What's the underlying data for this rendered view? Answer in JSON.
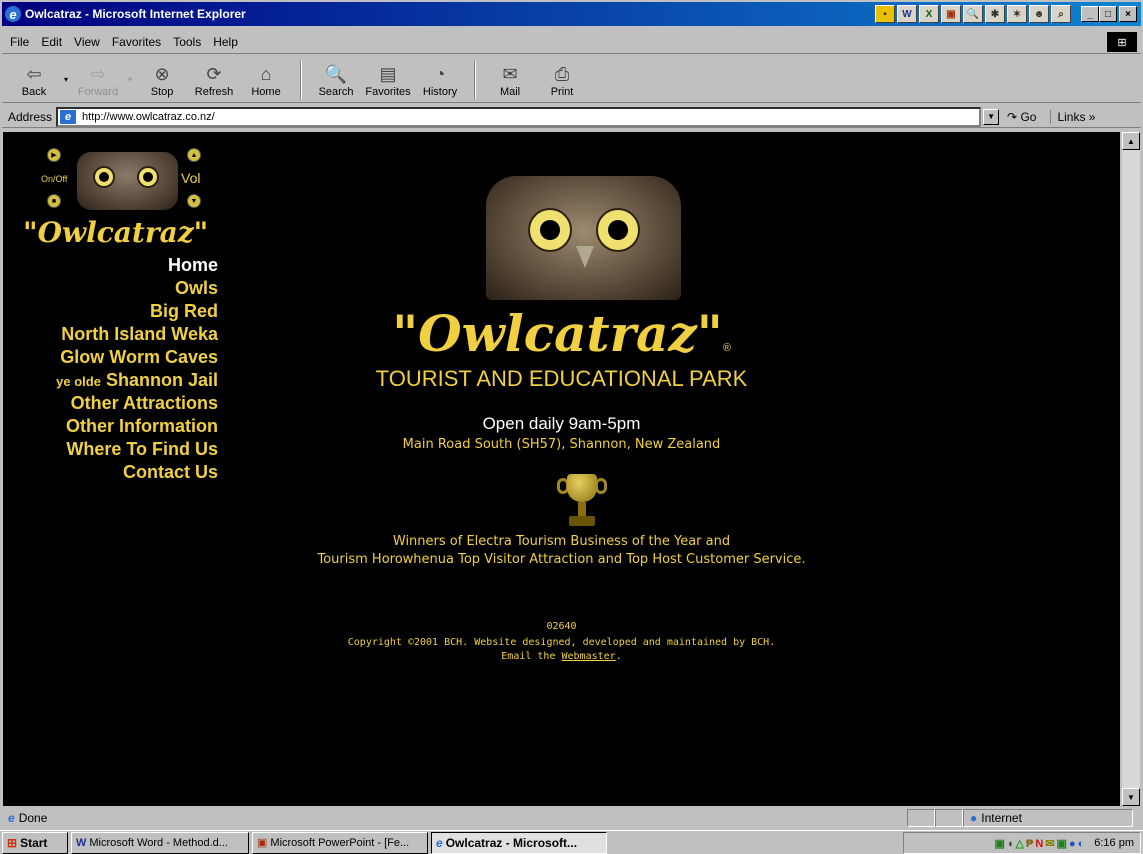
{
  "window": {
    "title": "Owlcatraz - Microsoft Internet Explorer",
    "caption_buttons": [
      "_",
      "□",
      "×"
    ]
  },
  "menu": [
    "File",
    "Edit",
    "View",
    "Favorites",
    "Tools",
    "Help"
  ],
  "toolbar": {
    "back": "Back",
    "forward": "Forward",
    "stop": "Stop",
    "refresh": "Refresh",
    "home": "Home",
    "search": "Search",
    "favorites": "Favorites",
    "history": "History",
    "mail": "Mail",
    "print": "Print"
  },
  "address": {
    "label": "Address",
    "url": "http://www.owlcatraz.co.nz/",
    "go": "Go",
    "links": "Links »"
  },
  "page": {
    "audio": {
      "onoff": "On/Off",
      "vol": "Vol"
    },
    "side_logo": "\"Owlcatraz\"",
    "nav": [
      {
        "label": "Home",
        "color": "#ffffff"
      },
      {
        "label": "Owls"
      },
      {
        "label": "Big Red"
      },
      {
        "label": "North Island Weka"
      },
      {
        "label": "Glow Worm Caves"
      },
      {
        "prefix": "ye olde",
        "label": "Shannon Jail"
      },
      {
        "label": "Other Attractions"
      },
      {
        "label": "Other Information"
      },
      {
        "label": "Where To Find Us"
      },
      {
        "label": "Contact Us"
      }
    ],
    "main_logo": "\"Owlcatraz\"",
    "registered": "®",
    "subtitle": "TOURIST AND EDUCATIONAL PARK",
    "open_prefix": "Open daily",
    "open_hours": "9am-5pm",
    "address_line": "Main Road South (SH57), Shannon, New Zealand",
    "award_line1": "Winners of Electra Tourism Business of the Year and",
    "award_line2": "Tourism Horowhenua Top Visitor Attraction and Top Host Customer Service.",
    "counter": "02640",
    "copyright": "Copyright ©2001 BCH. Website designed, developed and maintained by BCH.",
    "email_prefix": "Email the",
    "email_link": "Webmaster",
    "email_suffix": ".",
    "colors": {
      "accent": "#f0d040",
      "background": "#000000"
    }
  },
  "status": {
    "text": "Done",
    "zone": "Internet"
  },
  "taskbar": {
    "start": "Start",
    "items": [
      "Microsoft Word - Method.d...",
      "Microsoft PowerPoint - [Fe...",
      "Owlcatraz - Microsoft..."
    ],
    "time": "6:16 pm"
  }
}
